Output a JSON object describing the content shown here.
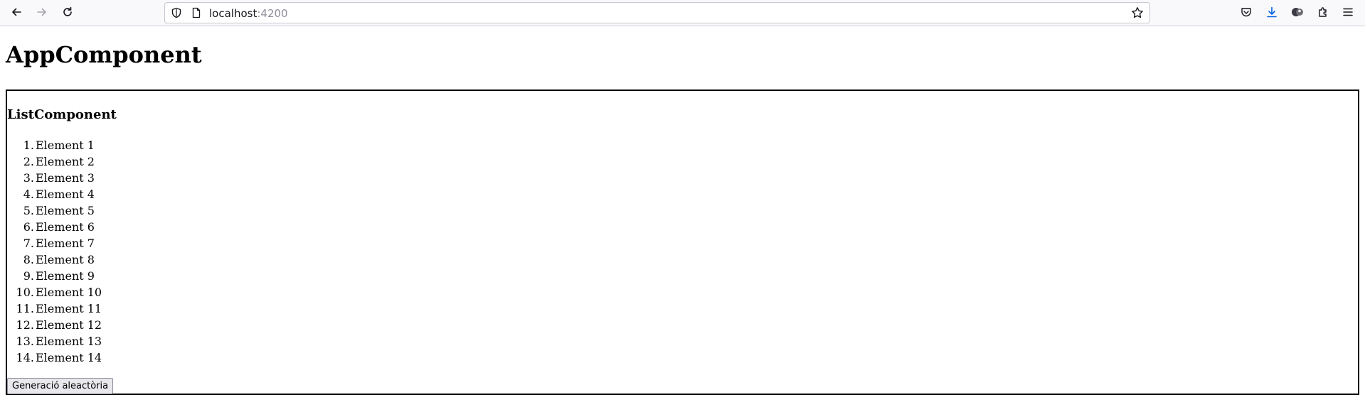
{
  "browser": {
    "url_host": "localhost",
    "url_port": ":4200",
    "icons": [
      "back-icon",
      "forward-icon",
      "reload-icon",
      "shield-icon",
      "page-icon",
      "star-icon",
      "pocket-icon",
      "download-icon",
      "account-icon",
      "extensions-icon",
      "menu-icon"
    ]
  },
  "app": {
    "title": "AppComponent"
  },
  "list_component": {
    "title": "ListComponent",
    "items": [
      {
        "num": "1.",
        "label": "Element 1"
      },
      {
        "num": "2.",
        "label": "Element 2"
      },
      {
        "num": "3.",
        "label": "Element 3"
      },
      {
        "num": "4.",
        "label": "Element 4"
      },
      {
        "num": "5.",
        "label": "Element 5"
      },
      {
        "num": "6.",
        "label": "Element 6"
      },
      {
        "num": "7.",
        "label": "Element 7"
      },
      {
        "num": "8.",
        "label": "Element 8"
      },
      {
        "num": "9.",
        "label": "Element 9"
      },
      {
        "num": "10.",
        "label": "Element 10"
      },
      {
        "num": "11.",
        "label": "Element 11"
      },
      {
        "num": "12.",
        "label": "Element 12"
      },
      {
        "num": "13.",
        "label": "Element 13"
      },
      {
        "num": "14.",
        "label": "Element 14"
      }
    ],
    "button_label": "Generació aleactòria"
  }
}
